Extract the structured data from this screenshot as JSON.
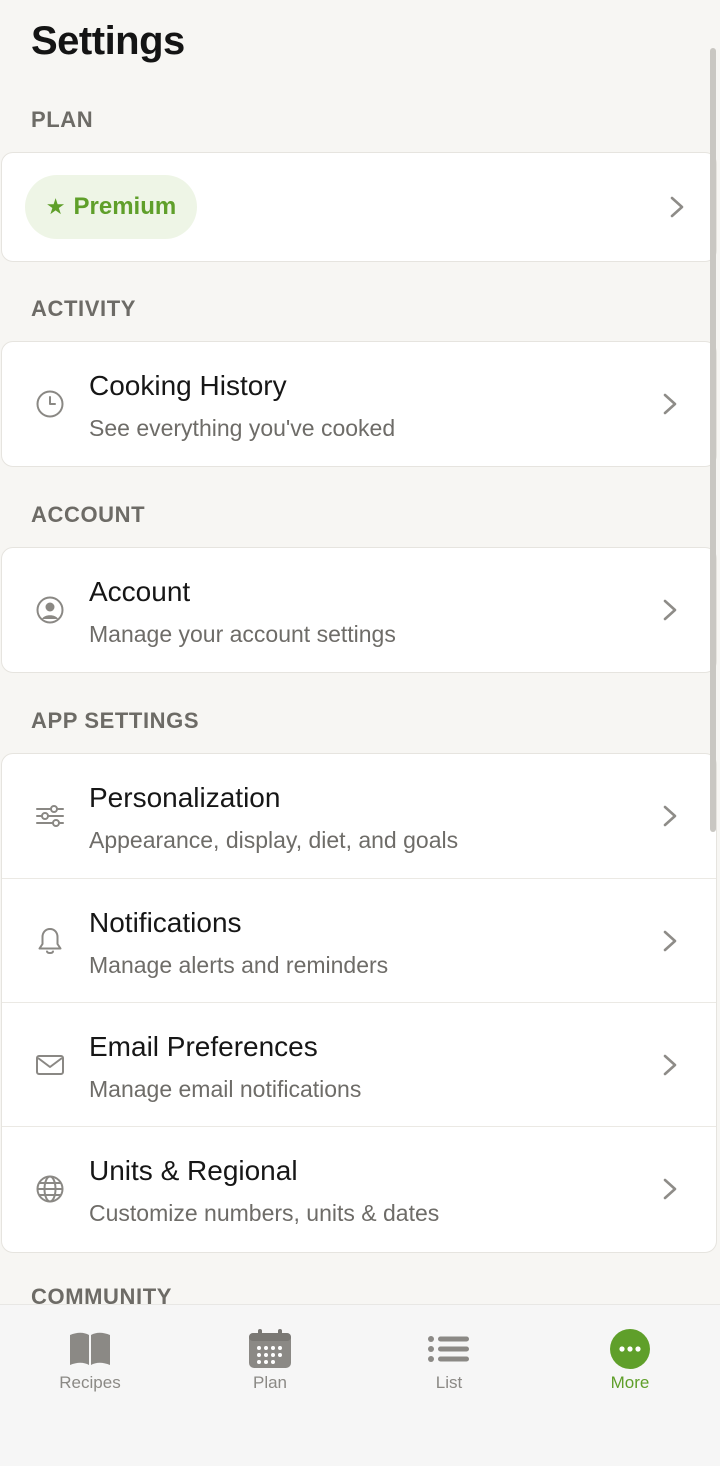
{
  "header": {
    "title": "Settings"
  },
  "sections": {
    "plan": {
      "label": "PLAN",
      "premium_label": "Premium",
      "star_icon": "star-icon"
    },
    "activity": {
      "label": "ACTIVITY",
      "items": [
        {
          "title": "Cooking History",
          "subtitle": "See everything you've cooked",
          "icon": "clock-icon"
        }
      ]
    },
    "account": {
      "label": "ACCOUNT",
      "items": [
        {
          "title": "Account",
          "subtitle": "Manage your account settings",
          "icon": "user-circle-icon"
        }
      ]
    },
    "app_settings": {
      "label": "APP SETTINGS",
      "items": [
        {
          "title": "Personalization",
          "subtitle": "Appearance, display, diet, and goals",
          "icon": "sliders-icon"
        },
        {
          "title": "Notifications",
          "subtitle": "Manage alerts and reminders",
          "icon": "bell-icon"
        },
        {
          "title": "Email Preferences",
          "subtitle": "Manage email notifications",
          "icon": "envelope-icon"
        },
        {
          "title": "Units & Regional",
          "subtitle": "Customize numbers, units & dates",
          "icon": "globe-icon"
        }
      ]
    },
    "community": {
      "label": "COMMUNITY"
    }
  },
  "tabbar": {
    "tabs": [
      {
        "label": "Recipes",
        "icon": "book-icon",
        "active": false
      },
      {
        "label": "Plan",
        "icon": "calendar-icon",
        "active": false
      },
      {
        "label": "List",
        "icon": "list-icon",
        "active": false
      },
      {
        "label": "More",
        "icon": "more-dots-icon",
        "active": true
      }
    ]
  },
  "colors": {
    "accent": "#5f9f2a",
    "premium_pill_bg": "#eef5e6",
    "background": "#f7f6f3",
    "section_label": "#6d6b66"
  }
}
